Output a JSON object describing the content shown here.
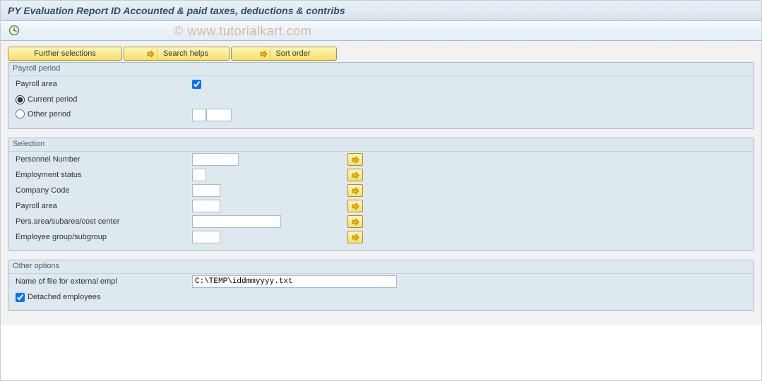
{
  "header": {
    "title": "PY Evaluation Report ID Accounted & paid taxes, deductions & contribs"
  },
  "watermark": "© www.tutorialkart.com",
  "buttons": {
    "further_selections": "Further selections",
    "search_helps": "Search helps",
    "sort_order": "Sort order"
  },
  "groups": {
    "payroll_period": {
      "title": "Payroll period",
      "payroll_area_label": "Payroll area",
      "current_period_label": "Current period",
      "other_period_label": "Other period"
    },
    "selection": {
      "title": "Selection",
      "personnel_number": "Personnel Number",
      "employment_status": "Employment status",
      "company_code": "Company Code",
      "payroll_area": "Payroll area",
      "pers_area": "Pers.area/subarea/cost center",
      "employee_group": "Employee group/subgroup"
    },
    "other_options": {
      "title": "Other options",
      "file_name_label": "Name of file for external empl",
      "file_name_value": "C:\\TEMP\\iddmmyyyy.txt",
      "detached_label": "Detached employees"
    }
  }
}
